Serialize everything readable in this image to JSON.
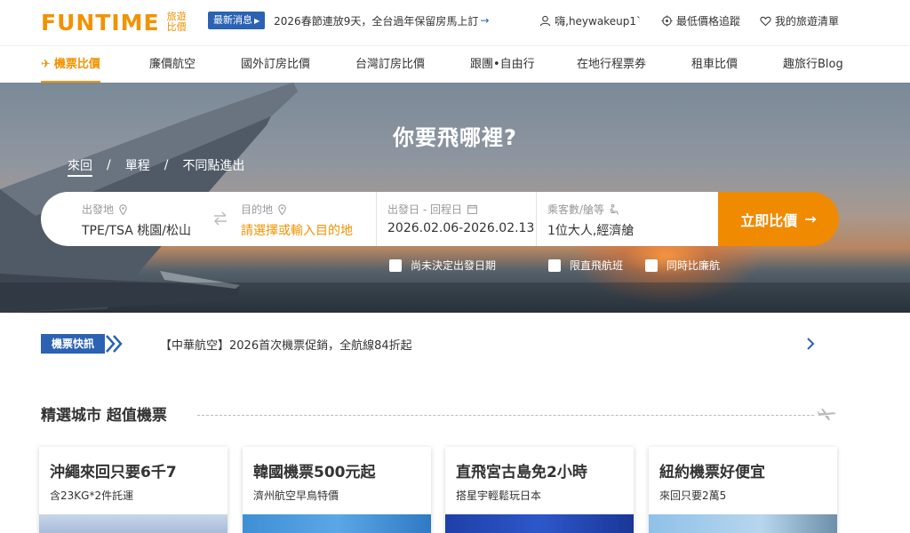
{
  "brand": {
    "logo_text": "FUNTIME",
    "logo_sub": "旅遊比價",
    "accent": "#f39200",
    "blue": "#2b62b3"
  },
  "header": {
    "news_badge": "最新消息",
    "news_text": "2026春節連放9天，全台過年保留房馬上訂",
    "user_greeting": "嗨,heywakeup1`",
    "price_tracking": "最低價格追蹤",
    "wishlist": "我的旅遊清單"
  },
  "nav": {
    "items": [
      {
        "label": "機票比價",
        "icon": "plane-icon",
        "active": true
      },
      {
        "label": "廉價航空"
      },
      {
        "label": "國外訂房比價"
      },
      {
        "label": "台灣訂房比價"
      },
      {
        "label": "跟團•自由行"
      },
      {
        "label": "在地行程票券"
      },
      {
        "label": "租車比價"
      },
      {
        "label": "趣旅行Blog"
      }
    ]
  },
  "hero": {
    "title": "你要飛哪裡?",
    "trip_types": [
      "來回",
      "單程",
      "不同點進出"
    ],
    "trip_separator": "/",
    "search": {
      "origin_label": "出發地",
      "origin_value": "TPE/TSA 桃園/松山",
      "dest_label": "目的地",
      "dest_value": "請選擇或輸入目的地",
      "date_label": "出發日 - 回程日",
      "date_value": "2026.02.06-2026.02.13",
      "pax_label": "乘客數/艙等",
      "pax_value": "1位大人,經濟艙",
      "button": "立即比價"
    },
    "checkboxes": [
      "尚未決定出發日期",
      "限直飛航班",
      "同時比廉航"
    ]
  },
  "ticker": {
    "badge": "機票快訊",
    "text": "【中華航空】2026首次機票促銷，全航線84折起"
  },
  "section": {
    "title": "精選城市 超值機票"
  },
  "cards": [
    {
      "title": "沖繩來回只要6千7",
      "subtitle": "含23KG*2件託運"
    },
    {
      "title": "韓國機票500元起",
      "subtitle": "濟州航空早鳥特價"
    },
    {
      "title": "直飛宮古島免2小時",
      "subtitle": "搭星宇輕鬆玩日本"
    },
    {
      "title": "紐約機票好便宜",
      "subtitle": "來回只要2萬5"
    }
  ]
}
